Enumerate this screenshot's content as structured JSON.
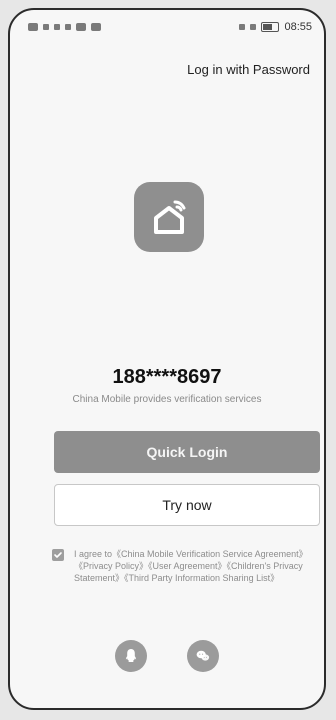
{
  "status_bar": {
    "time": "08:55"
  },
  "header": {
    "password_login_label": "Log in with Password"
  },
  "login": {
    "phone_number": "188****8697",
    "provider_text": "China Mobile provides verification services",
    "quick_login_label": "Quick Login",
    "try_now_label": "Try now"
  },
  "agreement": {
    "checked": true,
    "text": "I agree to《China Mobile Verification Service Agreement》《Privacy Policy》《User Agreement》《Children's Privacy Statement》《Third Party Information Sharing List》"
  },
  "social": {
    "icons": [
      "qq-icon",
      "wechat-icon"
    ]
  },
  "colors": {
    "primary_button": "#8e8e8e",
    "background": "#f7f7f7",
    "text_secondary": "#8a8a8a"
  }
}
